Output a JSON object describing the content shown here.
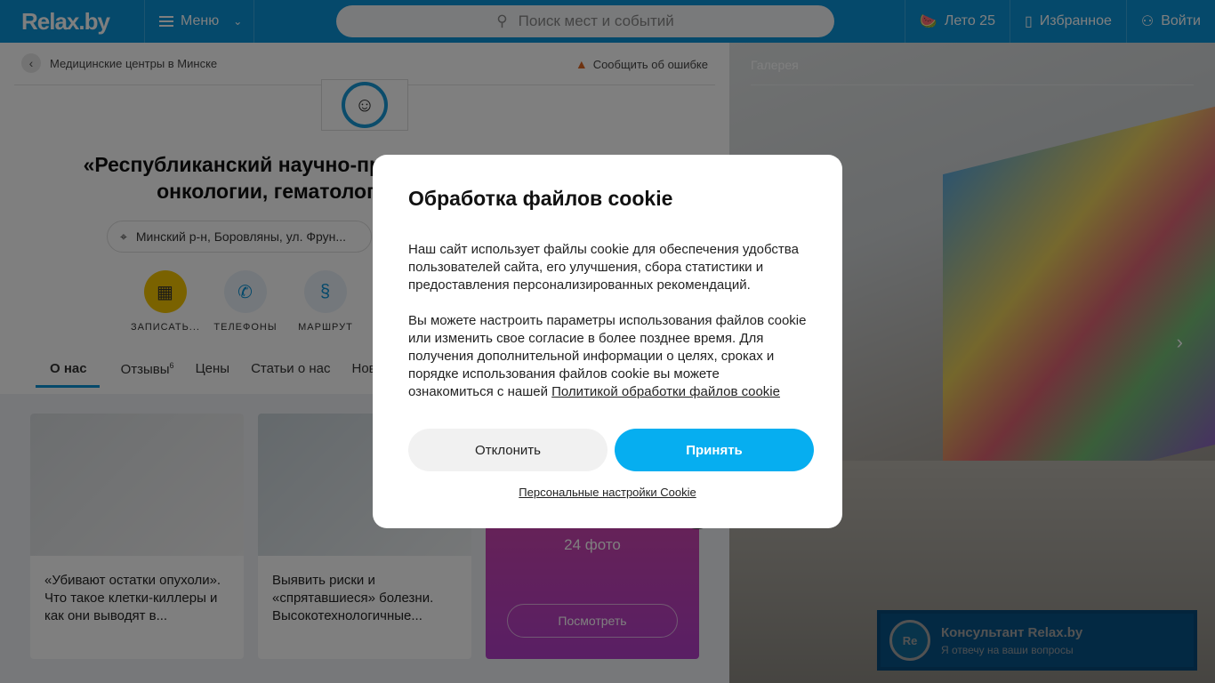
{
  "header": {
    "logo": "Relax.by",
    "menu_label": "Меню",
    "search_placeholder": "Поиск мест и событий",
    "summer_label": "Лето 25",
    "favorites_label": "Избранное",
    "login_label": "Войти"
  },
  "page": {
    "breadcrumb": "Медицинские центры в Минске",
    "report_label": "Сообщить об ошибке",
    "title": "«Республиканский научно-практический центр детской онкологии, гематологии и иммунологии»",
    "address": "Минский р-н, Боровляны, ул. Фрун...",
    "actions": [
      {
        "label": "ЗАПИСАТЬ..."
      },
      {
        "label": "ТЕЛЕФОНЫ"
      },
      {
        "label": "МАРШРУТ"
      }
    ],
    "tabs": [
      {
        "label": "О нас"
      },
      {
        "label": "Отзывы",
        "count": "6"
      },
      {
        "label": "Цены"
      },
      {
        "label": "Статьи о нас"
      },
      {
        "label": "Ново"
      }
    ],
    "cards": [
      {
        "text": "«Убивают остатки опухоли». Что такое клетки-киллеры и как они выводят в..."
      },
      {
        "text": "Выявить риски и «спрятавшиеся» болезни. Высокотехнологичные..."
      }
    ],
    "photos_count": "24 фото",
    "view_button": "Посмотреть"
  },
  "gallery": {
    "title": "Галерея"
  },
  "cookie_modal": {
    "title": "Обработка файлов cookie",
    "paragraph1": "Наш сайт использует файлы cookie для обеспечения удобства пользователей сайта, его улучшения, сбора статистики и предоставления персонализированных рекомендаций.",
    "paragraph2": "Вы можете настроить параметры использования файлов cookie или изменить свое согласие в более позднее время. Для получения дополнительной информации о целях, сроках и порядке использования файлов cookie вы можете ознакомиться с нашей ",
    "policy_link": "Политикой обработки файлов cookie",
    "decline_label": "Отклонить",
    "accept_label": "Принять",
    "settings_link": "Персональные настройки Cookie"
  },
  "chat": {
    "avatar_text": "Re",
    "title": "Консультант Relax.by",
    "subtitle": "Я отвечу на ваши вопросы"
  },
  "colors": {
    "brand": "#0b93d6",
    "accept": "#06aef0"
  }
}
